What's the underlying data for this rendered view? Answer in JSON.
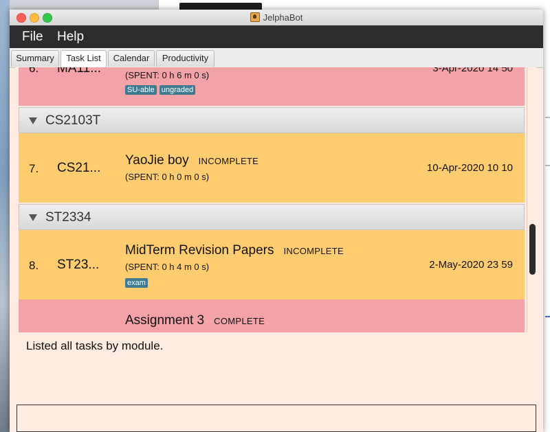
{
  "window": {
    "title": "JelphaBot"
  },
  "menu": [
    "File",
    "Help"
  ],
  "tabs": [
    {
      "label": "Summary"
    },
    {
      "label": "Task List"
    },
    {
      "label": "Calendar"
    },
    {
      "label": "Productivity"
    }
  ],
  "active_tab": "Task List",
  "tasks": {
    "top": {
      "index": "6.",
      "module": "MA11...",
      "spent": "(SPENT: 0 h 6 m 0 s)",
      "date": "3-Apr-2020 14 50",
      "tags": [
        "SU-able",
        "ungraded"
      ]
    },
    "group1": {
      "name": "CS2103T",
      "task": {
        "index": "7.",
        "module": "CS21...",
        "description": "YaoJie boy",
        "status": "INCOMPLETE",
        "spent": "(SPENT: 0 h 0 m 0 s)",
        "date": "10-Apr-2020 10 10"
      }
    },
    "group2": {
      "name": "ST2334",
      "task": {
        "index": "8.",
        "module": "ST23...",
        "description": "MidTerm Revision Papers",
        "status": "INCOMPLETE",
        "spent": "(SPENT: 0 h 4 m 0 s)",
        "date": "2-May-2020 23 59",
        "tags": [
          "exam"
        ]
      },
      "next": {
        "description": "Assignment 3",
        "status": "COMPLETE"
      }
    }
  },
  "result_text": "Listed all tasks by module.",
  "command_input": {
    "value": ""
  },
  "colors": {
    "incomplete_card": "#ffcc70",
    "complete_card": "#f3a3a7",
    "tag": "#3e7b91",
    "menubar": "#2b2d2f",
    "panel_bg": "#ffebe1"
  }
}
